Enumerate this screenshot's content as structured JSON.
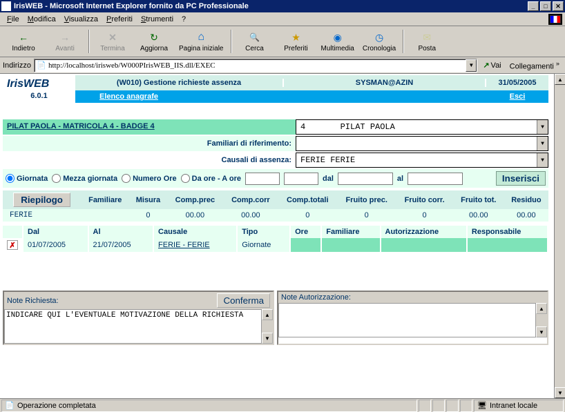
{
  "window": {
    "title": "IrisWEB - Microsoft Internet Explorer fornito da PC Professionale"
  },
  "menu": {
    "file": "File",
    "modifica": "Modifica",
    "visualizza": "Visualizza",
    "preferiti": "Preferiti",
    "strumenti": "Strumenti",
    "help": "?"
  },
  "toolbar": {
    "back": "Indietro",
    "forward": "Avanti",
    "stop": "Termina",
    "refresh": "Aggiorna",
    "home": "Pagina iniziale",
    "search": "Cerca",
    "favorites": "Preferiti",
    "media": "Multimedia",
    "history": "Cronologia",
    "mail": "Posta"
  },
  "address": {
    "label": "Indirizzo",
    "url": "http://localhost/irisweb/W000PIrisWEB_IIS.dll/EXEC",
    "go": "Vai",
    "links": "Collegamenti"
  },
  "app": {
    "brand": "IrisWEB",
    "version": "6.0.1",
    "page_title": "(W010) Gestione richieste assenza",
    "user": "SYSMAN@AZIN",
    "date": "31/05/2005",
    "nav_elenco": "Elenco anagrafe",
    "nav_esci": "Esci"
  },
  "person": {
    "label": "PILAT PAOLA - MATRICOLA 4 - BADGE 4",
    "select_value": "4       PILAT PAOLA"
  },
  "fields": {
    "familiari_label": "Familiari di riferimento:",
    "familiari_value": "",
    "causali_label": "Causali di assenza:",
    "causali_value": "FERIE FERIE"
  },
  "radios": {
    "giornata": "Giornata",
    "mezza": "Mezza giornata",
    "numero_ore": "Numero Ore",
    "da_a": "Da ore - A ore",
    "dal": "dal",
    "al": "al",
    "inserisci": "Inserisci"
  },
  "riepilogo": {
    "button": "Riepilogo",
    "headers": {
      "familiare": "Familiare",
      "misura": "Misura",
      "comp_prec": "Comp.prec",
      "comp_corr": "Comp.corr",
      "comp_totali": "Comp.totali",
      "fruito_prec": "Fruito prec.",
      "fruito_corr": "Fruito corr.",
      "fruito_tot": "Fruito tot.",
      "residuo": "Residuo"
    },
    "row": {
      "label": "FERIE",
      "familiare": "",
      "misura": "0",
      "comp_prec": "00.00",
      "comp_corr": "00.00",
      "comp_totali": "0",
      "fruito_prec": "0",
      "fruito_corr": "0",
      "fruito_tot": "00.00",
      "residuo": "00.00"
    }
  },
  "detail": {
    "headers": {
      "dal": "Dal",
      "al": "Al",
      "causale": "Causale",
      "tipo": "Tipo",
      "ore": "Ore",
      "familiare": "Familiare",
      "autorizzazione": "Autorizzazione",
      "responsabile": "Responsabile"
    },
    "row": {
      "dal": "01/07/2005",
      "al": "21/07/2005",
      "causale": "FERIE - FERIE",
      "tipo": "Giornate",
      "ore": "",
      "familiare": "",
      "autorizzazione": "",
      "responsabile": ""
    }
  },
  "notes": {
    "richiesta_label": "Note Richiesta:",
    "conferma": "Conferma",
    "richiesta_text": "INDICARE QUI L'EVENTUALE MOTIVAZIONE DELLA RICHIESTA",
    "autorizzazione_label": "Note Autorizzazione:",
    "autorizzazione_text": ""
  },
  "status": {
    "text": "Operazione completata",
    "zone": "Intranet locale"
  }
}
